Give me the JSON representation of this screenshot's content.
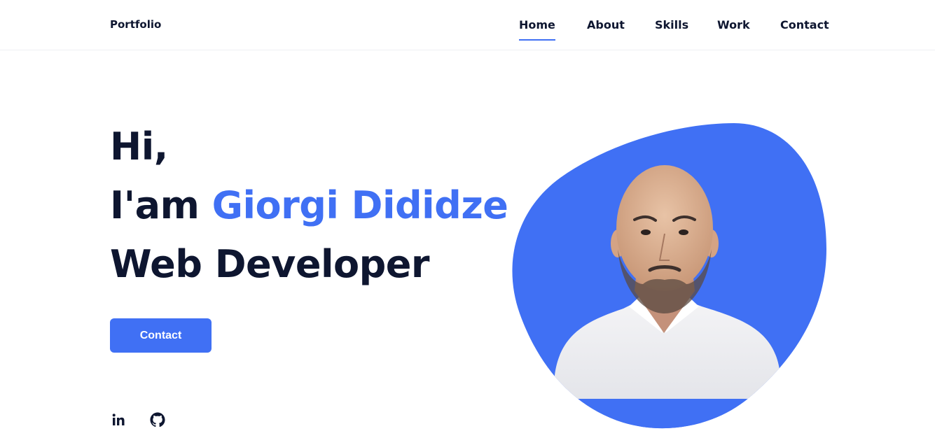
{
  "header": {
    "logo": "Portfolio",
    "nav": [
      {
        "label": "Home",
        "active": true
      },
      {
        "label": "About",
        "active": false
      },
      {
        "label": "Skills",
        "active": false
      },
      {
        "label": "Work",
        "active": false
      },
      {
        "label": "Contact",
        "active": false
      }
    ]
  },
  "hero": {
    "greeting": "Hi,",
    "intro_prefix": "I'am ",
    "name": "Giorgi Dididze",
    "role": "Web Developer",
    "cta_label": "Contact"
  },
  "social": [
    {
      "icon": "linkedin-icon",
      "label": "in"
    },
    {
      "icon": "github-icon"
    }
  ],
  "colors": {
    "accent": "#4070f4",
    "text": "#0e1630",
    "background": "#ffffff"
  },
  "image": {
    "description_icon": "profile-photo"
  }
}
